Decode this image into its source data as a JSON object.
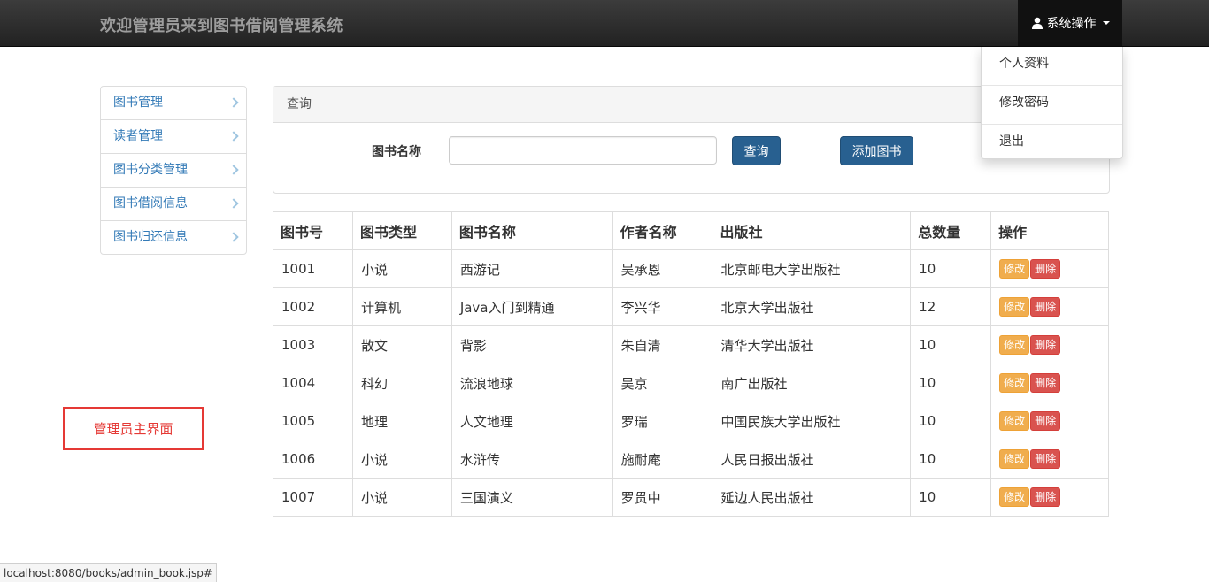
{
  "header": {
    "title": "欢迎管理员来到图书借阅管理系统",
    "system_menu_label": "系统操作",
    "dropdown": [
      "个人资料",
      "修改密码",
      "退出"
    ]
  },
  "sidebar": {
    "items": [
      {
        "label": "图书管理"
      },
      {
        "label": "读者管理"
      },
      {
        "label": "图书分类管理"
      },
      {
        "label": "图书借阅信息"
      },
      {
        "label": "图书归还信息"
      }
    ]
  },
  "search": {
    "panel_title": "查询",
    "label": "图书名称",
    "value": "",
    "query_button": "查询",
    "add_button": "添加图书"
  },
  "table": {
    "headers": [
      "图书号",
      "图书类型",
      "图书名称",
      "作者名称",
      "出版社",
      "总数量",
      "操作"
    ],
    "rows": [
      [
        "1001",
        "小说",
        "西游记",
        "吴承恩",
        "北京邮电大学出版社",
        "10"
      ],
      [
        "1002",
        "计算机",
        "Java入门到精通",
        "李兴华",
        "北京大学出版社",
        "12"
      ],
      [
        "1003",
        "散文",
        "背影",
        "朱自清",
        "清华大学出版社",
        "10"
      ],
      [
        "1004",
        "科幻",
        "流浪地球",
        "吴京",
        "南广出版社",
        "10"
      ],
      [
        "1005",
        "地理",
        "人文地理",
        "罗瑞",
        "中国民族大学出版社",
        "10"
      ],
      [
        "1006",
        "小说",
        "水浒传",
        "施耐庵",
        "人民日报出版社",
        "10"
      ],
      [
        "1007",
        "小说",
        "三国演义",
        "罗贯中",
        "延边人民出版社",
        "10"
      ]
    ],
    "edit_label": "修改",
    "delete_label": "删除"
  },
  "annotation": "管理员主界面",
  "status_url": "localhost:8080/books/admin_book.jsp#"
}
